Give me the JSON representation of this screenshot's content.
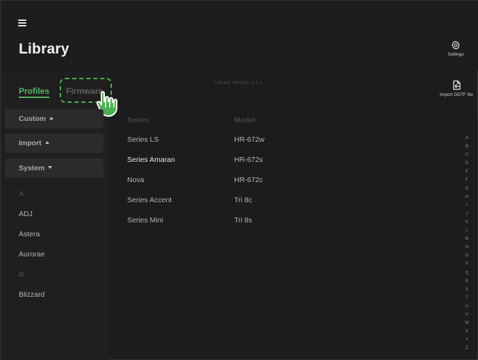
{
  "header": {
    "title": "Library",
    "settings_label": "Settings",
    "menu_icon": "hamburger-icon",
    "settings_icon": "gear-icon"
  },
  "tabs": [
    {
      "label": "Profiles",
      "active": true
    },
    {
      "label": "Firmware",
      "active": false
    }
  ],
  "groups": [
    {
      "label": "Custom",
      "caret": "up"
    },
    {
      "label": "Import",
      "caret": "up"
    },
    {
      "label": "System",
      "caret": "down"
    }
  ],
  "brands": {
    "sections": [
      {
        "letter": "A",
        "items": [
          "ADJ",
          "Astera",
          "Aurorae"
        ]
      },
      {
        "letter": "B",
        "items": [
          "Blizzard"
        ]
      }
    ]
  },
  "main": {
    "version": "Library Version 1.1.1",
    "series_header": "Series",
    "model_header": "Model",
    "series": [
      "Series LS",
      "Series Amaran",
      "Nova",
      "Series Accent",
      "Series Mini"
    ],
    "selected_series": "Series Amaran",
    "models": [
      "HR-672w",
      "HR-672s",
      "HR-672c",
      "Tri 8c",
      "Tri 8s"
    ]
  },
  "import_gdtf": {
    "label": "Import GDTF file",
    "icon": "import-file-icon"
  },
  "alphabet": [
    "A",
    "B",
    "C",
    "D",
    "E",
    "F",
    "G",
    "H",
    "I",
    "J",
    "K",
    "L",
    "M",
    "N",
    "O",
    "P",
    "Q",
    "R",
    "S",
    "T",
    "U",
    "V",
    "W",
    "X",
    "Y",
    "Z"
  ],
  "colors": {
    "accent": "#57b85f",
    "background": "#1c1c1c",
    "sidebar": "#1f1f1f",
    "button": "#2b2b2b"
  },
  "annotation": {
    "hand_icon": "pointing-hand-icon"
  }
}
